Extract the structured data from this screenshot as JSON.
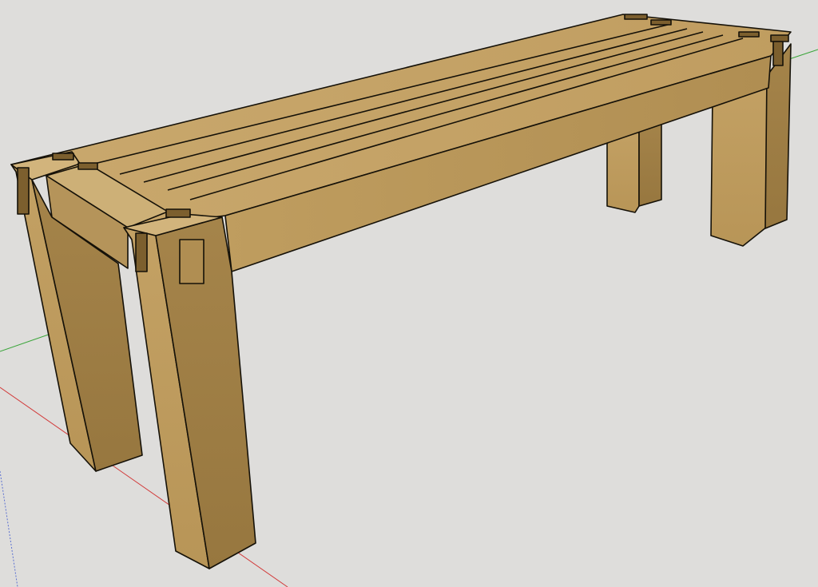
{
  "viewport": {
    "background_color": "#dedddb"
  },
  "scene": {
    "model": "bench",
    "material_colors": {
      "top_face": "#c8a76c",
      "front_face": "#b8975a",
      "side_face": "#9d7c44",
      "end_grain": "#d2b47c",
      "joint_shadow": "#7c5f2e",
      "edge_line": "#151108"
    },
    "axes": {
      "red_axis_color": "#d23a3a",
      "green_axis_color": "#3aa53a",
      "blue_axis_color": "#5a6fd0"
    }
  }
}
